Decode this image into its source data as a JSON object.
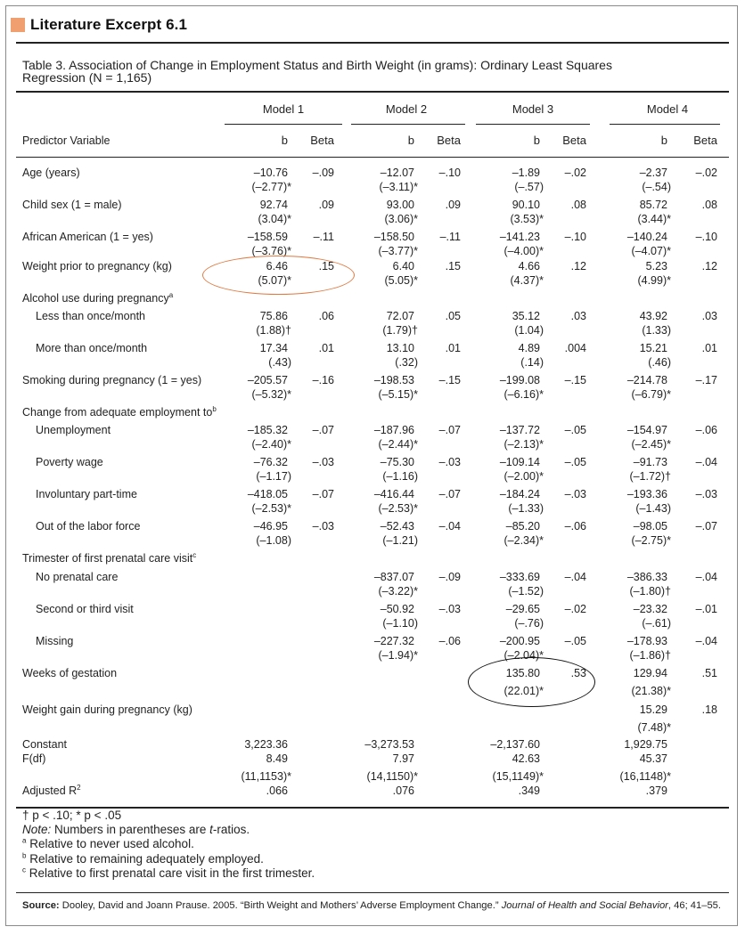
{
  "header": {
    "title": "Literature Excerpt 6.1",
    "accent_color": "#f0a070"
  },
  "table": {
    "caption_line1": "Table 3.  Association of Change in Employment Status and Birth Weight (in grams): Ordinary Least Squares",
    "caption_line2": "Regression (N = 1,165)",
    "models": [
      "Model 1",
      "Model 2",
      "Model 3",
      "Model 4"
    ],
    "predictor_header": "Predictor Variable",
    "col_b": "b",
    "col_beta": "Beta",
    "rows": [
      {
        "label": "Age (years)",
        "indent": false,
        "b": [
          "–10.76",
          "–12.07",
          "–1.89",
          "–2.37"
        ],
        "t": [
          "(–2.77)*",
          "(–3.11)*",
          "(–.57)",
          "(–.54)"
        ],
        "beta": [
          "–.09",
          "–.10",
          "–.02",
          "–.02"
        ]
      },
      {
        "label": "Child sex (1 = male)",
        "indent": false,
        "b": [
          "92.74",
          "93.00",
          "90.10",
          "85.72"
        ],
        "t": [
          "(3.04)*",
          "(3.06)*",
          "(3.53)*",
          "(3.44)*"
        ],
        "beta": [
          ".09",
          ".09",
          ".08",
          ".08"
        ]
      },
      {
        "label": "African American (1 = yes)",
        "indent": false,
        "b": [
          "–158.59",
          "–158.50",
          "–141.23",
          "–140.24"
        ],
        "t": [
          "(–3.76)*",
          "(–3.77)*",
          "(–4.00)*",
          "(–4.07)*"
        ],
        "beta": [
          "–.11",
          "–.11",
          "–.10",
          "–.10"
        ]
      },
      {
        "label": "Weight prior to pregnancy (kg)",
        "indent": false,
        "b": [
          "6.46",
          "6.40",
          "4.66",
          "5.23"
        ],
        "t": [
          "(5.07)*",
          "(5.05)*",
          "(4.37)*",
          "(4.99)*"
        ],
        "beta": [
          ".15",
          ".15",
          ".12",
          ".12"
        ]
      },
      {
        "label": "Alcohol use during pregnancy",
        "sup": "a",
        "indent": false,
        "b": [
          "",
          "",
          "",
          ""
        ],
        "t": [
          "",
          "",
          "",
          ""
        ],
        "beta": [
          "",
          "",
          "",
          ""
        ]
      },
      {
        "label": "Less than once/month",
        "indent": true,
        "b": [
          "75.86",
          "72.07",
          "35.12",
          "43.92"
        ],
        "t": [
          "(1.88)†",
          "(1.79)†",
          "(1.04)",
          "(1.33)"
        ],
        "beta": [
          ".06",
          ".05",
          ".03",
          ".03"
        ]
      },
      {
        "label": "More than once/month",
        "indent": true,
        "b": [
          "17.34",
          "13.10",
          "4.89",
          "15.21"
        ],
        "t": [
          "(.43)",
          "(.32)",
          "(.14)",
          "(.46)"
        ],
        "beta": [
          ".01",
          ".01",
          ".004",
          ".01"
        ]
      },
      {
        "label": "Smoking during pregnancy (1 = yes)",
        "indent": false,
        "b": [
          "–205.57",
          "–198.53",
          "–199.08",
          "–214.78"
        ],
        "t": [
          "(–5.32)*",
          "(–5.15)*",
          "(–6.16)*",
          "(–6.79)*"
        ],
        "beta": [
          "–.16",
          "–.15",
          "–.15",
          "–.17"
        ]
      },
      {
        "label": "Change from adequate employment to",
        "sup": "b",
        "indent": false,
        "b": [
          "",
          "",
          "",
          ""
        ],
        "t": [
          "",
          "",
          "",
          ""
        ],
        "beta": [
          "",
          "",
          "",
          ""
        ]
      },
      {
        "label": "Unemployment",
        "indent": true,
        "b": [
          "–185.32",
          "–187.96",
          "–137.72",
          "–154.97"
        ],
        "t": [
          "(–2.40)*",
          "(–2.44)*",
          "(–2.13)*",
          "(–2.45)*"
        ],
        "beta": [
          "–.07",
          "–.07",
          "–.05",
          "–.06"
        ]
      },
      {
        "label": "Poverty wage",
        "indent": true,
        "b": [
          "–76.32",
          "–75.30",
          "–109.14",
          "–91.73"
        ],
        "t": [
          "(–1.17)",
          "(–1.16)",
          "(–2.00)*",
          "(–1.72)†"
        ],
        "beta": [
          "–.03",
          "–.03",
          "–.05",
          "–.04"
        ]
      },
      {
        "label": "Involuntary part-time",
        "indent": true,
        "b": [
          "–418.05",
          "–416.44",
          "–184.24",
          "–193.36"
        ],
        "t": [
          "(–2.53)*",
          "(–2.53)*",
          "(–1.33)",
          "(–1.43)"
        ],
        "beta": [
          "–.07",
          "–.07",
          "–.03",
          "–.03"
        ]
      },
      {
        "label": "Out of the labor force",
        "indent": true,
        "b": [
          "–46.95",
          "–52.43",
          "–85.20",
          "–98.05"
        ],
        "t": [
          "(–1.08)",
          "(–1.21)",
          "(–2.34)*",
          "(–2.75)*"
        ],
        "beta": [
          "–.03",
          "–.04",
          "–.06",
          "–.07"
        ]
      },
      {
        "label": "Trimester of first prenatal care visit",
        "sup": "c",
        "indent": false,
        "b": [
          "",
          "",
          "",
          ""
        ],
        "t": [
          "",
          "",
          "",
          ""
        ],
        "beta": [
          "",
          "",
          "",
          ""
        ]
      },
      {
        "label": "No prenatal care",
        "indent": true,
        "b": [
          "",
          "–837.07",
          "–333.69",
          "–386.33"
        ],
        "t": [
          "",
          "(–3.22)*",
          "(–1.52)",
          "(–1.80)†"
        ],
        "beta": [
          "",
          "–.09",
          "–.04",
          "–.04"
        ]
      },
      {
        "label": "Second or third visit",
        "indent": true,
        "b": [
          "",
          "–50.92",
          "–29.65",
          "–23.32"
        ],
        "t": [
          "",
          "(–1.10)",
          "(–.76)",
          "(–.61)"
        ],
        "beta": [
          "",
          "–.03",
          "–.02",
          "–.01"
        ]
      },
      {
        "label": "Missing",
        "indent": true,
        "b": [
          "",
          "–227.32",
          "–200.95",
          "–178.93"
        ],
        "t": [
          "",
          "(–1.94)*",
          "(–2.04)*",
          "(–1.86)†"
        ],
        "beta": [
          "",
          "–.06",
          "–.05",
          "–.04"
        ]
      },
      {
        "label": "Weeks of gestation",
        "indent": false,
        "b": [
          "",
          "",
          "135.80",
          "129.94"
        ],
        "t": [
          "",
          "",
          "(22.01)*",
          "(21.38)*"
        ],
        "beta": [
          "",
          "",
          ".53",
          ".51"
        ]
      },
      {
        "label": "Weight gain during pregnancy (kg)",
        "indent": false,
        "b": [
          "",
          "",
          "",
          "15.29"
        ],
        "t": [
          "",
          "",
          "",
          "(7.48)*"
        ],
        "beta": [
          "",
          "",
          "",
          ".18"
        ]
      }
    ],
    "summary": {
      "constant_label": "Constant",
      "f_label": "F(df)",
      "r2_label": "Adjusted R",
      "r2_sup": "2",
      "constant": [
        "3,223.36",
        "–3,273.53",
        "–2,137.60",
        "1,929.75"
      ],
      "f": [
        "8.49",
        "7.97",
        "42.63",
        "45.37"
      ],
      "df": [
        "(11,1153)*",
        "(14,1150)*",
        "(15,1149)*",
        "(16,1148)*"
      ],
      "r2": [
        ".066",
        ".076",
        ".349",
        ".379"
      ]
    },
    "notes": {
      "sig": "† p < .10; * p < .05",
      "note_label": "Note:",
      "note_text": " Numbers in parentheses are ",
      "note_t": "t",
      "note_end": "-ratios.",
      "fn_a_mark": "a",
      "fn_a": " Relative to never used alcohol.",
      "fn_b_mark": "b",
      "fn_b": " Relative to remaining adequately employed.",
      "fn_c_mark": "c",
      "fn_c": " Relative to first prenatal care visit in the first trimester."
    },
    "source": {
      "label": "Source:",
      "text": " Dooley, David and Joann Prause. 2005. “Birth Weight and Mothers’ Adverse Employment Change.” ",
      "journal": "Journal of Health and Social Behavior",
      "tail": ", 46; 41–55."
    },
    "annotations": {
      "model1_oval_color": "#e07840",
      "model3_oval_color": "#111111"
    }
  }
}
